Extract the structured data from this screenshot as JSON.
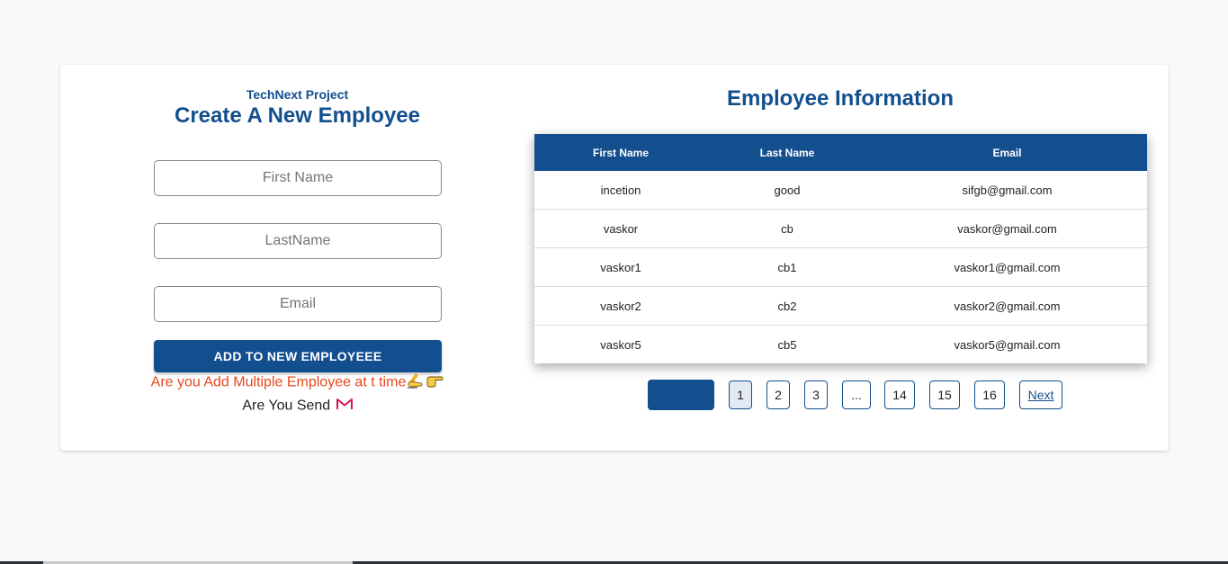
{
  "form": {
    "project_label": "TechNext Project",
    "title": "Create A New Employee",
    "first_name_placeholder": "First Name",
    "last_name_placeholder": "LastName",
    "email_placeholder": "Email",
    "add_button_label": "ADD TO NEW EMPLOYEEE",
    "multiple_link_text": "Are you Add Multiple Employee at t time",
    "multiple_link_icons": [
      "writing-hand-icon",
      "pointing-hand-icon"
    ],
    "send_link_text": "Are You Send",
    "send_link_icon": "gmail-icon"
  },
  "table": {
    "title": "Employee Information",
    "columns": [
      "First Name",
      "Last Name",
      "Email"
    ],
    "rows": [
      [
        "incetion",
        "good",
        "sifgb@gmail.com"
      ],
      [
        "vaskor",
        "cb",
        "vaskor@gmail.com"
      ],
      [
        "vaskor1",
        "cb1",
        "vaskor1@gmail.com"
      ],
      [
        "vaskor2",
        "cb2",
        "vaskor2@gmail.com"
      ],
      [
        "vaskor5",
        "cb5",
        "vaskor5@gmail.com"
      ]
    ]
  },
  "pagination": {
    "previous_label": "",
    "pages": [
      "1",
      "2",
      "3",
      "...",
      "14",
      "15",
      "16"
    ],
    "active_page": "1",
    "next_label": "Next"
  },
  "colors": {
    "primary": "#134f8f",
    "accent": "#e8491d",
    "background": "#f9f9f9"
  }
}
